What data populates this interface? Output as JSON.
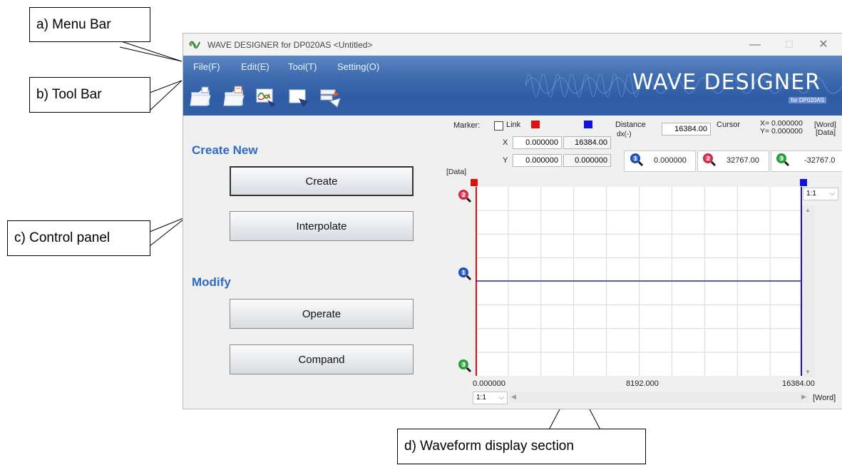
{
  "callouts": {
    "menu_bar": "a) Menu Bar",
    "tool_bar": "b) Tool Bar",
    "control_panel": "c) Control panel",
    "waveform": "d) Waveform display section"
  },
  "window": {
    "title": "WAVE DESIGNER for DP020AS <Untitled>",
    "min_glyph": "—",
    "max_glyph": "☐",
    "close_glyph": "✕"
  },
  "menu": {
    "file": "File(F)",
    "edit": "Edit(E)",
    "tool": "Tool(T)",
    "setting": "Setting(O)"
  },
  "logo": {
    "text": "WAVE DESIGNER",
    "sub": "for DP020AS"
  },
  "control_panel": {
    "create_new": "Create New",
    "create": "Create",
    "interpolate": "Interpolate",
    "modify": "Modify",
    "operate": "Operate",
    "compand": "Compand"
  },
  "marker": {
    "marker_label": "Marker:",
    "link_label": "Link",
    "distance_label": "Distance",
    "dx_label": "dx(-)",
    "distance_value": "16384.00",
    "cursor_label": "Cursor",
    "cursor_x": "X= 0.000000",
    "cursor_y": "Y= 0.000000",
    "word_unit": "[Word]",
    "data_unit": "[Data]",
    "x_label": "X",
    "y_label": "Y",
    "x_red": "0.000000",
    "x_blue": "16384.00",
    "y_red": "0.000000",
    "y_blue": "0.000000",
    "mag1_value": "0.000000",
    "mag2_value": "32767.00",
    "mag3_value": "-32767.0"
  },
  "plot": {
    "y_unit": "[Data]",
    "x_min": "0.000000",
    "x_mid": "8192.000",
    "x_max": "16384.00",
    "x_unit": "[Word]",
    "zoom_y": "1:1",
    "zoom_x": "1:1",
    "colors": {
      "red_marker": "#e01010",
      "blue_marker": "#1010e0",
      "waveform": "#2b2b9a",
      "grid": "#d9d9d9"
    }
  }
}
